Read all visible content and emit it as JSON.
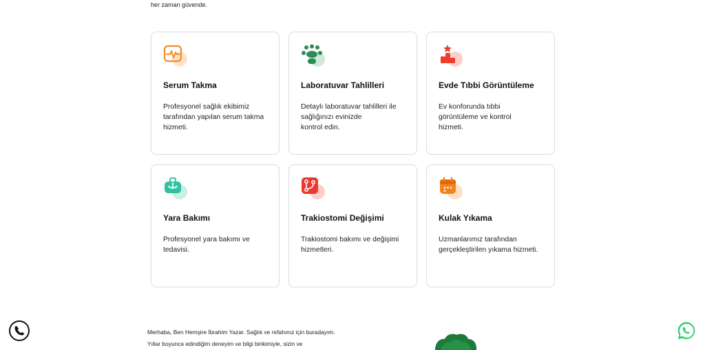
{
  "intro": {
    "tail_text": "her zaman güvende."
  },
  "services": [
    {
      "title": "Serum Takma",
      "desc_lines": [
        "Profesyonel sağlık ekibimiz",
        "tarafından yapılan serum takma",
        "hizmeti."
      ],
      "icon": "heart-monitor-icon",
      "color": "#f28c28"
    },
    {
      "title": "Laboratuvar Tahlilleri",
      "desc_lines": [
        "Detaylı laboratuvar tahlilleri ile",
        "sağlığınızı evinizde",
        "kontrol edin."
      ],
      "icon": "lab-team-icon",
      "color": "#2e8b57"
    },
    {
      "title": "Evde Tıbbi Görüntüleme",
      "desc_lines": [
        "Ev konforunda tıbbi",
        "görüntüleme ve kontrol",
        "hizmeti."
      ],
      "icon": "podium-star-icon",
      "color": "#ef3b2c"
    },
    {
      "title": "Yara Bakımı",
      "desc_lines": [
        "Profesyonel yara bakımı ve",
        "tedavisi."
      ],
      "icon": "wound-kit-icon",
      "color": "#2ec4a0"
    },
    {
      "title": "Trakiostomi Değişimi",
      "desc_lines": [
        "Trakiostomi bakımı ve değişimi",
        "hizmetleri."
      ],
      "icon": "branch-route-icon",
      "color": "#ea3a30"
    },
    {
      "title": "Kulak Yıkama",
      "desc_lines": [
        "Uzmanlarımız tarafından",
        "gerçekleştirilen yıkama hizmeti."
      ],
      "icon": "calendar-icon",
      "color": "#f5821f"
    }
  ],
  "about": {
    "lines": [
      "Merhaba, Ben Hemşire İbrahim Yazar. Sağlık ve refahınız için buradayım.",
      "Yıllar boyunca edindiğim deneyim ve bilgi birikimiyle, sizin ve"
    ]
  },
  "floating": {
    "phone_icon": "phone-icon",
    "whatsapp_icon": "whatsapp-icon",
    "whatsapp_color": "#25d366"
  }
}
